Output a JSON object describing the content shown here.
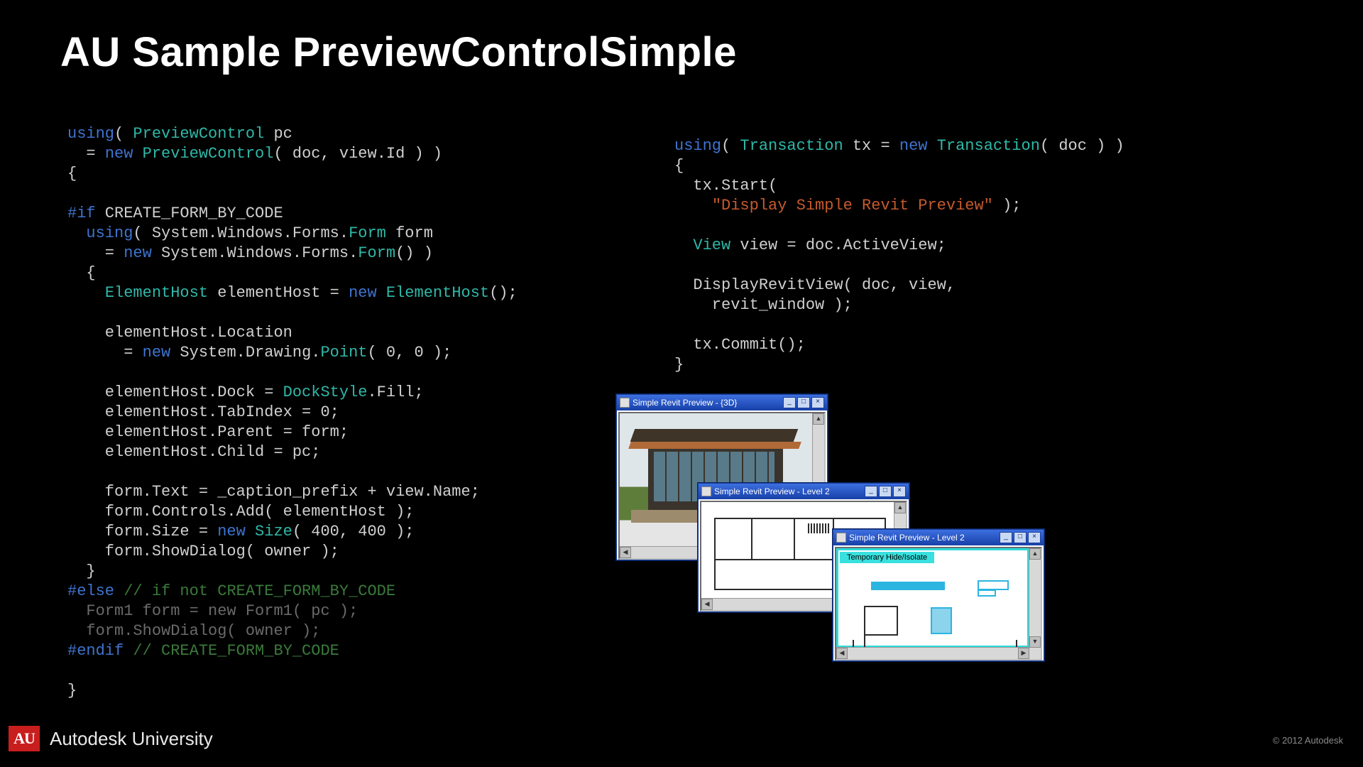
{
  "title": "AU Sample PreviewControlSimple",
  "code_left": [
    {
      "t": "line",
      "spans": [
        {
          "c": "kw",
          "v": "using"
        },
        {
          "v": "( "
        },
        {
          "c": "type",
          "v": "PreviewControl"
        },
        {
          "v": " pc"
        }
      ]
    },
    {
      "t": "line",
      "spans": [
        {
          "v": "  = "
        },
        {
          "c": "kw",
          "v": "new"
        },
        {
          "v": " "
        },
        {
          "c": "type",
          "v": "PreviewControl"
        },
        {
          "v": "( doc, view.Id ) )"
        }
      ]
    },
    {
      "t": "line",
      "spans": [
        {
          "v": "{"
        }
      ]
    },
    {
      "t": "blank"
    },
    {
      "t": "line",
      "spans": [
        {
          "c": "kw",
          "v": "#if"
        },
        {
          "v": " CREATE_FORM_BY_CODE"
        }
      ]
    },
    {
      "t": "line",
      "spans": [
        {
          "v": "  "
        },
        {
          "c": "kw",
          "v": "using"
        },
        {
          "v": "( System.Windows.Forms."
        },
        {
          "c": "type",
          "v": "Form"
        },
        {
          "v": " form"
        }
      ]
    },
    {
      "t": "line",
      "spans": [
        {
          "v": "    = "
        },
        {
          "c": "kw",
          "v": "new"
        },
        {
          "v": " System.Windows.Forms."
        },
        {
          "c": "type",
          "v": "Form"
        },
        {
          "v": "() )"
        }
      ]
    },
    {
      "t": "line",
      "spans": [
        {
          "v": "  {"
        }
      ]
    },
    {
      "t": "line",
      "spans": [
        {
          "v": "    "
        },
        {
          "c": "type",
          "v": "ElementHost"
        },
        {
          "v": " elementHost = "
        },
        {
          "c": "kw",
          "v": "new"
        },
        {
          "v": " "
        },
        {
          "c": "type",
          "v": "ElementHost"
        },
        {
          "v": "();"
        }
      ]
    },
    {
      "t": "blank"
    },
    {
      "t": "line",
      "spans": [
        {
          "v": "    elementHost.Location"
        }
      ]
    },
    {
      "t": "line",
      "spans": [
        {
          "v": "      = "
        },
        {
          "c": "kw",
          "v": "new"
        },
        {
          "v": " System.Drawing."
        },
        {
          "c": "type",
          "v": "Point"
        },
        {
          "v": "( 0, 0 );"
        }
      ]
    },
    {
      "t": "blank"
    },
    {
      "t": "line",
      "spans": [
        {
          "v": "    elementHost.Dock = "
        },
        {
          "c": "type",
          "v": "DockStyle"
        },
        {
          "v": ".Fill;"
        }
      ]
    },
    {
      "t": "line",
      "spans": [
        {
          "v": "    elementHost.TabIndex = 0;"
        }
      ]
    },
    {
      "t": "line",
      "spans": [
        {
          "v": "    elementHost.Parent = form;"
        }
      ]
    },
    {
      "t": "line",
      "spans": [
        {
          "v": "    elementHost.Child = pc;"
        }
      ]
    },
    {
      "t": "blank"
    },
    {
      "t": "line",
      "spans": [
        {
          "v": "    form.Text = _caption_prefix + view.Name;"
        }
      ]
    },
    {
      "t": "line",
      "spans": [
        {
          "v": "    form.Controls.Add( elementHost );"
        }
      ]
    },
    {
      "t": "line",
      "spans": [
        {
          "v": "    form.Size = "
        },
        {
          "c": "kw",
          "v": "new"
        },
        {
          "v": " "
        },
        {
          "c": "type",
          "v": "Size"
        },
        {
          "v": "( 400, 400 );"
        }
      ]
    },
    {
      "t": "line",
      "spans": [
        {
          "v": "    form.ShowDialog( owner );"
        }
      ]
    },
    {
      "t": "line",
      "spans": [
        {
          "v": "  }"
        }
      ]
    },
    {
      "t": "line",
      "spans": [
        {
          "c": "kw",
          "v": "#else"
        },
        {
          "v": " "
        },
        {
          "c": "cmt",
          "v": "// if not CREATE_FORM_BY_CODE"
        }
      ]
    },
    {
      "t": "line",
      "spans": [
        {
          "c": "dim",
          "v": "  Form1 form = new Form1( pc );"
        }
      ]
    },
    {
      "t": "line",
      "spans": [
        {
          "c": "dim",
          "v": "  form.ShowDialog( owner );"
        }
      ]
    },
    {
      "t": "line",
      "spans": [
        {
          "c": "kw",
          "v": "#endif"
        },
        {
          "v": " "
        },
        {
          "c": "cmt",
          "v": "// CREATE_FORM_BY_CODE"
        }
      ]
    },
    {
      "t": "blank"
    },
    {
      "t": "line",
      "spans": [
        {
          "v": "}"
        }
      ]
    }
  ],
  "code_right": [
    {
      "t": "line",
      "spans": [
        {
          "c": "kw",
          "v": "using"
        },
        {
          "v": "( "
        },
        {
          "c": "type",
          "v": "Transaction"
        },
        {
          "v": " tx = "
        },
        {
          "c": "kw",
          "v": "new"
        },
        {
          "v": " "
        },
        {
          "c": "type",
          "v": "Transaction"
        },
        {
          "v": "( doc ) )"
        }
      ]
    },
    {
      "t": "line",
      "spans": [
        {
          "v": "{"
        }
      ]
    },
    {
      "t": "line",
      "spans": [
        {
          "v": "  tx.Start("
        }
      ]
    },
    {
      "t": "line",
      "spans": [
        {
          "v": "    "
        },
        {
          "c": "str",
          "v": "\"Display Simple Revit Preview\""
        },
        {
          "v": " );"
        }
      ]
    },
    {
      "t": "blank"
    },
    {
      "t": "line",
      "spans": [
        {
          "v": "  "
        },
        {
          "c": "type",
          "v": "View"
        },
        {
          "v": " view = doc.ActiveView;"
        }
      ]
    },
    {
      "t": "blank"
    },
    {
      "t": "line",
      "spans": [
        {
          "v": "  DisplayRevitView( doc, view,"
        }
      ]
    },
    {
      "t": "line",
      "spans": [
        {
          "v": "    revit_window );"
        }
      ]
    },
    {
      "t": "blank"
    },
    {
      "t": "line",
      "spans": [
        {
          "v": "  tx.Commit();"
        }
      ]
    },
    {
      "t": "line",
      "spans": [
        {
          "v": "}"
        }
      ]
    }
  ],
  "windows": {
    "w1_title": "Simple Revit Preview - {3D}",
    "w2_title": "Simple Revit Preview - Level 2",
    "w3_title": "Simple Revit Preview - Level 2",
    "w3_tag": "Temporary Hide/Isolate",
    "btn_min": "_",
    "btn_max": "□",
    "btn_close": "×"
  },
  "footer": {
    "badge": "AU",
    "label": "Autodesk University",
    "copyright": "© 2012 Autodesk"
  }
}
